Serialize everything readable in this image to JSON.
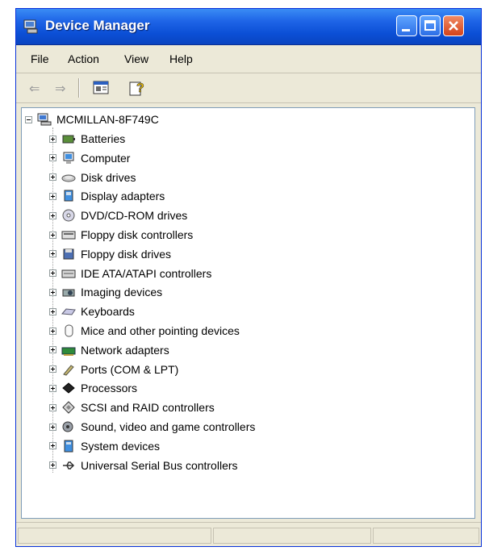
{
  "window": {
    "title": "Device Manager"
  },
  "menu": {
    "items": [
      "File",
      "Action",
      "View",
      "Help"
    ]
  },
  "tree": {
    "root": "MCMILLAN-8F749C",
    "items": [
      {
        "label": "Batteries",
        "icon": "battery-icon"
      },
      {
        "label": "Computer",
        "icon": "computer-icon"
      },
      {
        "label": "Disk drives",
        "icon": "disk-drive-icon"
      },
      {
        "label": "Display adapters",
        "icon": "display-adapter-icon"
      },
      {
        "label": "DVD/CD-ROM drives",
        "icon": "dvd-drive-icon"
      },
      {
        "label": "Floppy disk controllers",
        "icon": "floppy-controller-icon"
      },
      {
        "label": "Floppy disk drives",
        "icon": "floppy-drive-icon"
      },
      {
        "label": "IDE ATA/ATAPI controllers",
        "icon": "ide-controller-icon"
      },
      {
        "label": "Imaging devices",
        "icon": "imaging-device-icon"
      },
      {
        "label": "Keyboards",
        "icon": "keyboard-icon"
      },
      {
        "label": "Mice and other pointing devices",
        "icon": "mouse-icon"
      },
      {
        "label": "Network adapters",
        "icon": "network-adapter-icon"
      },
      {
        "label": "Ports (COM & LPT)",
        "icon": "port-icon"
      },
      {
        "label": "Processors",
        "icon": "processor-icon"
      },
      {
        "label": "SCSI and RAID controllers",
        "icon": "scsi-controller-icon"
      },
      {
        "label": "Sound, video and game controllers",
        "icon": "sound-icon"
      },
      {
        "label": "System devices",
        "icon": "system-device-icon"
      },
      {
        "label": "Universal Serial Bus controllers",
        "icon": "usb-icon"
      }
    ]
  },
  "colors": {
    "titlebar": "#0b4fd6",
    "chrome": "#ece9d8",
    "close": "#d5421a"
  }
}
